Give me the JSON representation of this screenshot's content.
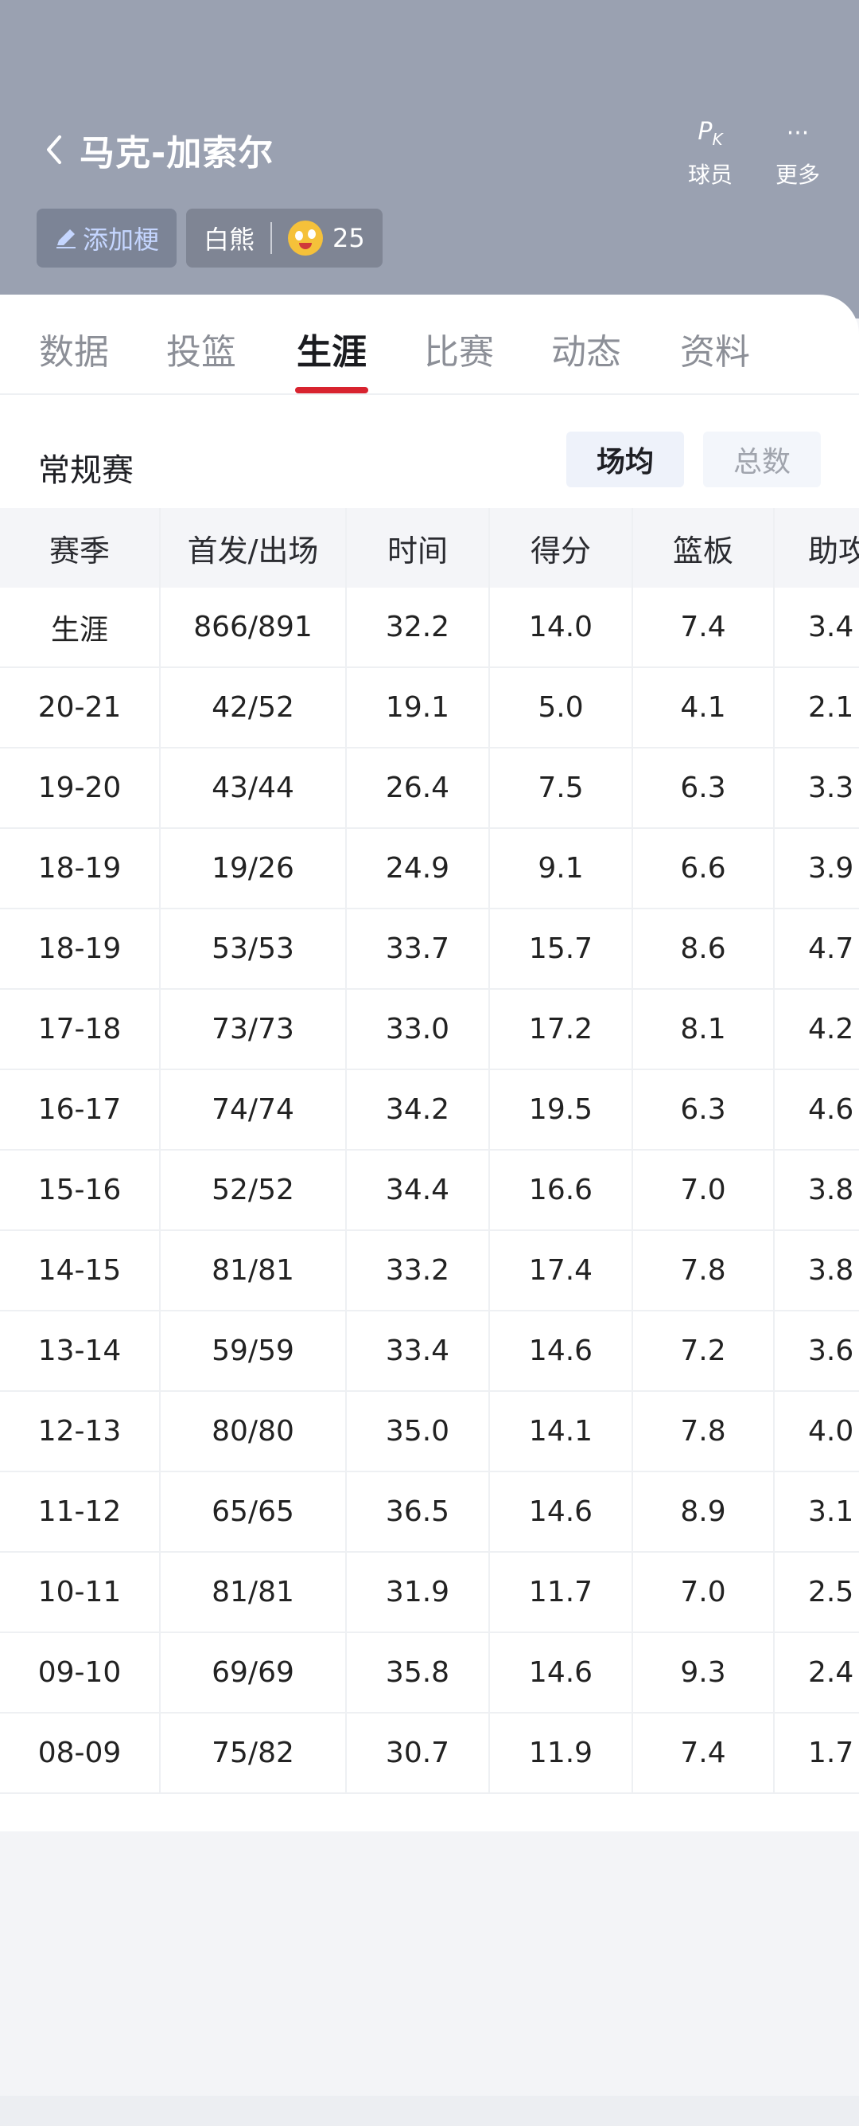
{
  "header": {
    "back_icon": "chevron-left-icon",
    "player_name": "马克-加索尔",
    "pk_label": "球员",
    "pk_icon_text": "P",
    "pk_icon_sub": "K",
    "more_label": "更多",
    "more_icon_text": "···"
  },
  "tags": {
    "add_meme": "添加梗",
    "nickname": "白熊",
    "emoji_count": "25"
  },
  "tabs": [
    "数据",
    "投篮",
    "生涯",
    "比赛",
    "动态",
    "资料"
  ],
  "active_tab": "生涯",
  "section": {
    "title": "常规赛",
    "avg_label": "场均",
    "total_label": "总数"
  },
  "table": {
    "headers": [
      "赛季",
      "首发/出场",
      "时间",
      "得分",
      "篮板",
      "助攻"
    ],
    "rows": [
      [
        "生涯",
        "866/891",
        "32.2",
        "14.0",
        "7.4",
        "3.4"
      ],
      [
        "20-21",
        "42/52",
        "19.1",
        "5.0",
        "4.1",
        "2.1"
      ],
      [
        "19-20",
        "43/44",
        "26.4",
        "7.5",
        "6.3",
        "3.3"
      ],
      [
        "18-19",
        "19/26",
        "24.9",
        "9.1",
        "6.6",
        "3.9"
      ],
      [
        "18-19",
        "53/53",
        "33.7",
        "15.7",
        "8.6",
        "4.7"
      ],
      [
        "17-18",
        "73/73",
        "33.0",
        "17.2",
        "8.1",
        "4.2"
      ],
      [
        "16-17",
        "74/74",
        "34.2",
        "19.5",
        "6.3",
        "4.6"
      ],
      [
        "15-16",
        "52/52",
        "34.4",
        "16.6",
        "7.0",
        "3.8"
      ],
      [
        "14-15",
        "81/81",
        "33.2",
        "17.4",
        "7.8",
        "3.8"
      ],
      [
        "13-14",
        "59/59",
        "33.4",
        "14.6",
        "7.2",
        "3.6"
      ],
      [
        "12-13",
        "80/80",
        "35.0",
        "14.1",
        "7.8",
        "4.0"
      ],
      [
        "11-12",
        "65/65",
        "36.5",
        "14.6",
        "8.9",
        "3.1"
      ],
      [
        "10-11",
        "81/81",
        "31.9",
        "11.7",
        "7.0",
        "2.5"
      ],
      [
        "09-10",
        "69/69",
        "35.8",
        "14.6",
        "9.3",
        "2.4"
      ],
      [
        "08-09",
        "75/82",
        "30.7",
        "11.9",
        "7.4",
        "1.7"
      ]
    ]
  },
  "colors": {
    "header_bg": "#9aa1b1",
    "accent": "#d8232f"
  }
}
